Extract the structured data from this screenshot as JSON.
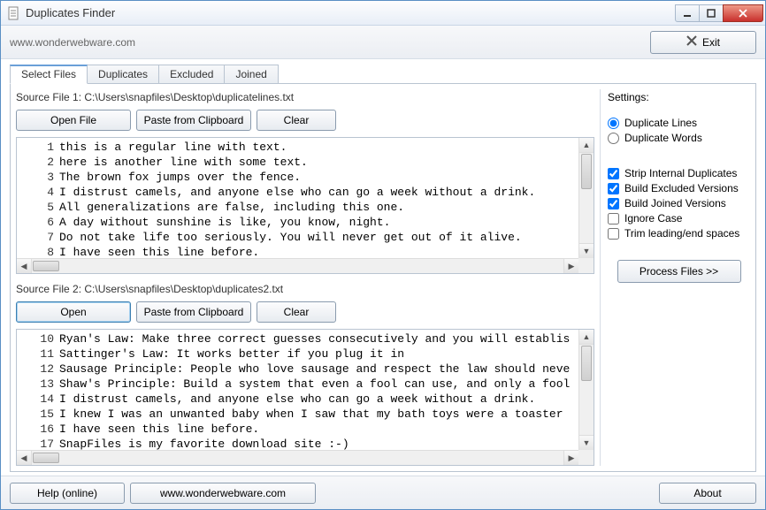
{
  "window": {
    "title": "Duplicates Finder"
  },
  "toolbar": {
    "url": "www.wonderwebware.com",
    "exit_label": "Exit"
  },
  "tabs": [
    "Select Files",
    "Duplicates",
    "Excluded",
    "Joined"
  ],
  "active_tab": 0,
  "source1": {
    "label": "Source File 1: C:\\Users\\snapfiles\\Desktop\\duplicatelines.txt",
    "open_label": "Open File",
    "paste_label": "Paste from Clipboard",
    "clear_label": "Clear",
    "lines": [
      {
        "n": 1,
        "t": "this is a regular line with text."
      },
      {
        "n": 2,
        "t": "here is another line with some text."
      },
      {
        "n": 3,
        "t": "The brown fox jumps over the fence."
      },
      {
        "n": 4,
        "t": "I distrust camels, and anyone else who can go a week without a drink."
      },
      {
        "n": 5,
        "t": "All generalizations are false, including this one."
      },
      {
        "n": 6,
        "t": "A day without sunshine is like, you know, night."
      },
      {
        "n": 7,
        "t": "Do not take life too seriously. You will never get out of it alive."
      },
      {
        "n": 8,
        "t": "I have seen this line before."
      }
    ]
  },
  "source2": {
    "label": "Source File 2: C:\\Users\\snapfiles\\Desktop\\duplicates2.txt",
    "open_label": "Open",
    "paste_label": "Paste from Clipboard",
    "clear_label": "Clear",
    "lines": [
      {
        "n": 10,
        "t": "Ryan's Law: Make three correct guesses consecutively and you will establis"
      },
      {
        "n": 11,
        "t": "Sattinger's Law: It works better if you plug it in"
      },
      {
        "n": 12,
        "t": "Sausage Principle: People who love sausage and respect the law should neve"
      },
      {
        "n": 13,
        "t": "Shaw's Principle: Build a system that even a fool can use, and only a fool"
      },
      {
        "n": 14,
        "t": "I distrust camels, and anyone else who can go a week without a drink."
      },
      {
        "n": 15,
        "t": "I knew I was an unwanted baby when I saw that my bath toys were a toaster"
      },
      {
        "n": 16,
        "t": "I have seen this line before."
      },
      {
        "n": 17,
        "t": "SnapFiles is my favorite download site :-)"
      }
    ]
  },
  "settings": {
    "title": "Settings:",
    "mode": {
      "lines": "Duplicate Lines",
      "words": "Duplicate Words",
      "selected": "lines"
    },
    "checks": {
      "strip": {
        "label": "Strip Internal Duplicates",
        "checked": true
      },
      "excluded": {
        "label": "Build Excluded Versions",
        "checked": true
      },
      "joined": {
        "label": "Build Joined Versions",
        "checked": true
      },
      "ignorecase": {
        "label": "Ignore Case",
        "checked": false
      },
      "trim": {
        "label": "Trim leading/end spaces",
        "checked": false
      }
    },
    "process_label": "Process Files  >>"
  },
  "footer": {
    "help_label": "Help (online)",
    "site_label": "www.wonderwebware.com",
    "about_label": "About"
  }
}
